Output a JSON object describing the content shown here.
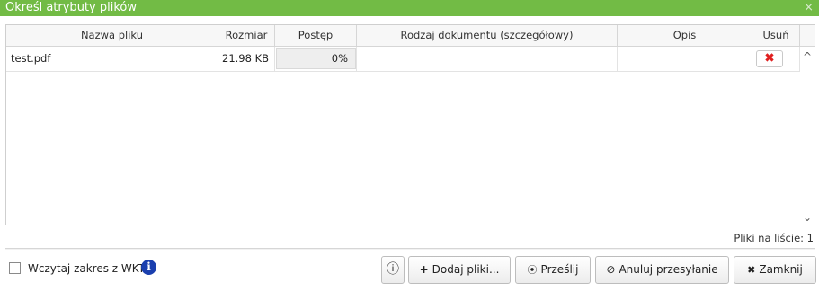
{
  "dialog": {
    "title": "Określ atrybuty plików",
    "close_glyph": "×"
  },
  "table": {
    "columns": [
      "Nazwa pliku",
      "Rozmiar",
      "Postęp",
      "Rodzaj dokumentu (szczegółowy)",
      "Opis",
      "Usuń"
    ],
    "rows": [
      {
        "name": "test.pdf",
        "size": "21.98 KB",
        "progress": "0%",
        "doc_type": "",
        "description": "",
        "delete_icon": "✖"
      }
    ]
  },
  "scrollbar": {
    "up_glyph": "^",
    "down_glyph": "⌄"
  },
  "status": {
    "file_count_label": "Pliki na liście: 1"
  },
  "footer": {
    "checkbox_label": "Wczytaj zakres z WKT",
    "checkbox_checked": false,
    "info_glyph": "i",
    "buttons": {
      "info": {
        "icon": "ⓘ"
      },
      "add": {
        "icon": "+",
        "label": "Dodaj pliki..."
      },
      "send": {
        "icon": "⦿",
        "label": "Prześlij"
      },
      "cancel": {
        "icon": "⊘",
        "label": "Anuluj przesyłanie"
      },
      "close": {
        "icon": "✖",
        "label": "Zamknij"
      }
    }
  },
  "colors": {
    "titlebar": "#72bb45",
    "delete": "#e02020",
    "info_badge": "#1a3fae"
  }
}
